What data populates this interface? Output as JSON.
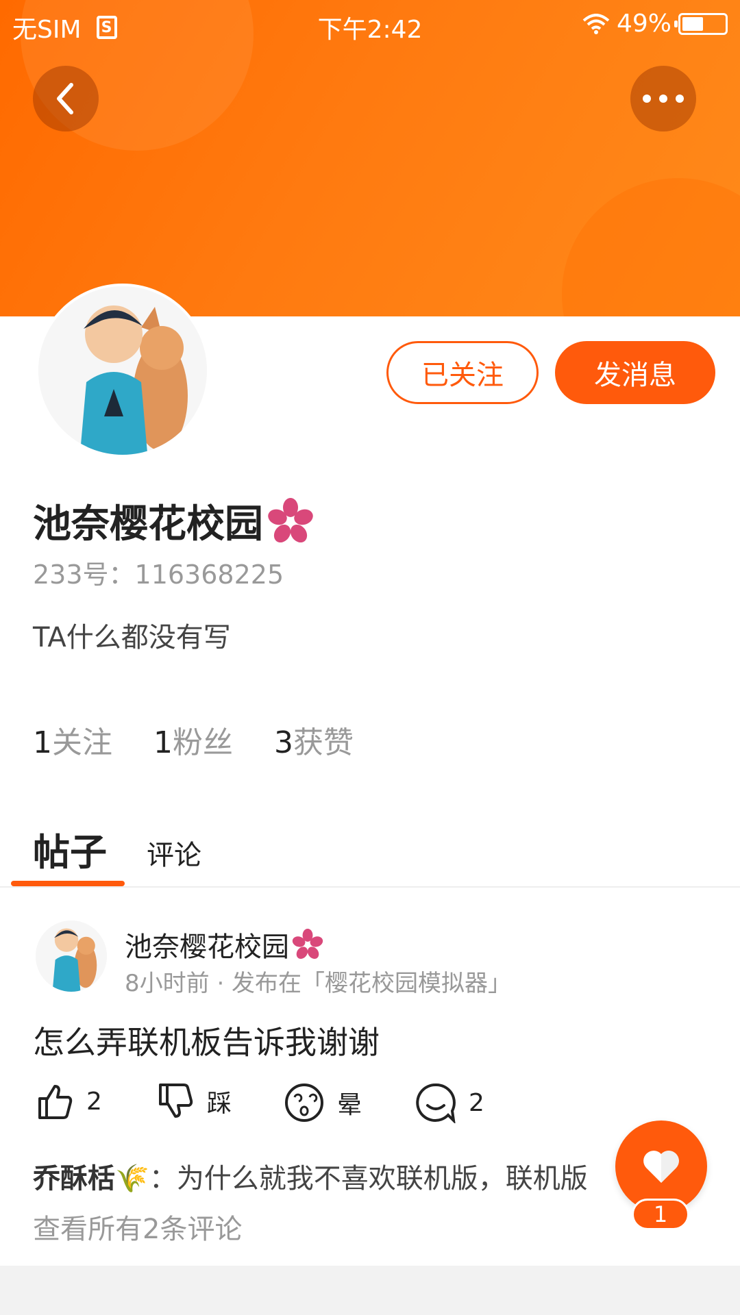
{
  "status_bar": {
    "carrier": "无SIM",
    "time": "下午2:42",
    "battery_percent": "49%",
    "battery_level": 0.49
  },
  "actions_top": {
    "back_icon": "chevron-left-icon",
    "more_icon": "more-dots-icon"
  },
  "profile": {
    "follow_label": "已关注",
    "message_label": "发消息",
    "name": "池奈樱花校园",
    "id_text": "233号：116368225",
    "bio": "TA什么都没有写",
    "stats": [
      {
        "num": "1",
        "label": "关注"
      },
      {
        "num": "1",
        "label": "粉丝"
      },
      {
        "num": "3",
        "label": "获赞"
      }
    ]
  },
  "tabs": [
    {
      "label": "帖子",
      "active": true
    },
    {
      "label": "评论",
      "active": false
    }
  ],
  "post": {
    "author": "池奈樱花校园",
    "meta": "8小时前 · 发布在「樱花校园模拟器」",
    "text": "怎么弄联机板告诉我谢谢",
    "actions": {
      "like_count": "2",
      "dislike_label": "踩",
      "dizzy_label": "晕",
      "comment_count": "2"
    },
    "comment_preview": {
      "author": "乔酥栝",
      "text": "为什么就我不喜欢联机版，联机版"
    },
    "view_all": "查看所有2条评论"
  },
  "fab": {
    "badge": "1"
  },
  "colors": {
    "accent": "#ff5a0c",
    "banner_start": "#ff6a00",
    "banner_end": "#ff8a1a"
  }
}
